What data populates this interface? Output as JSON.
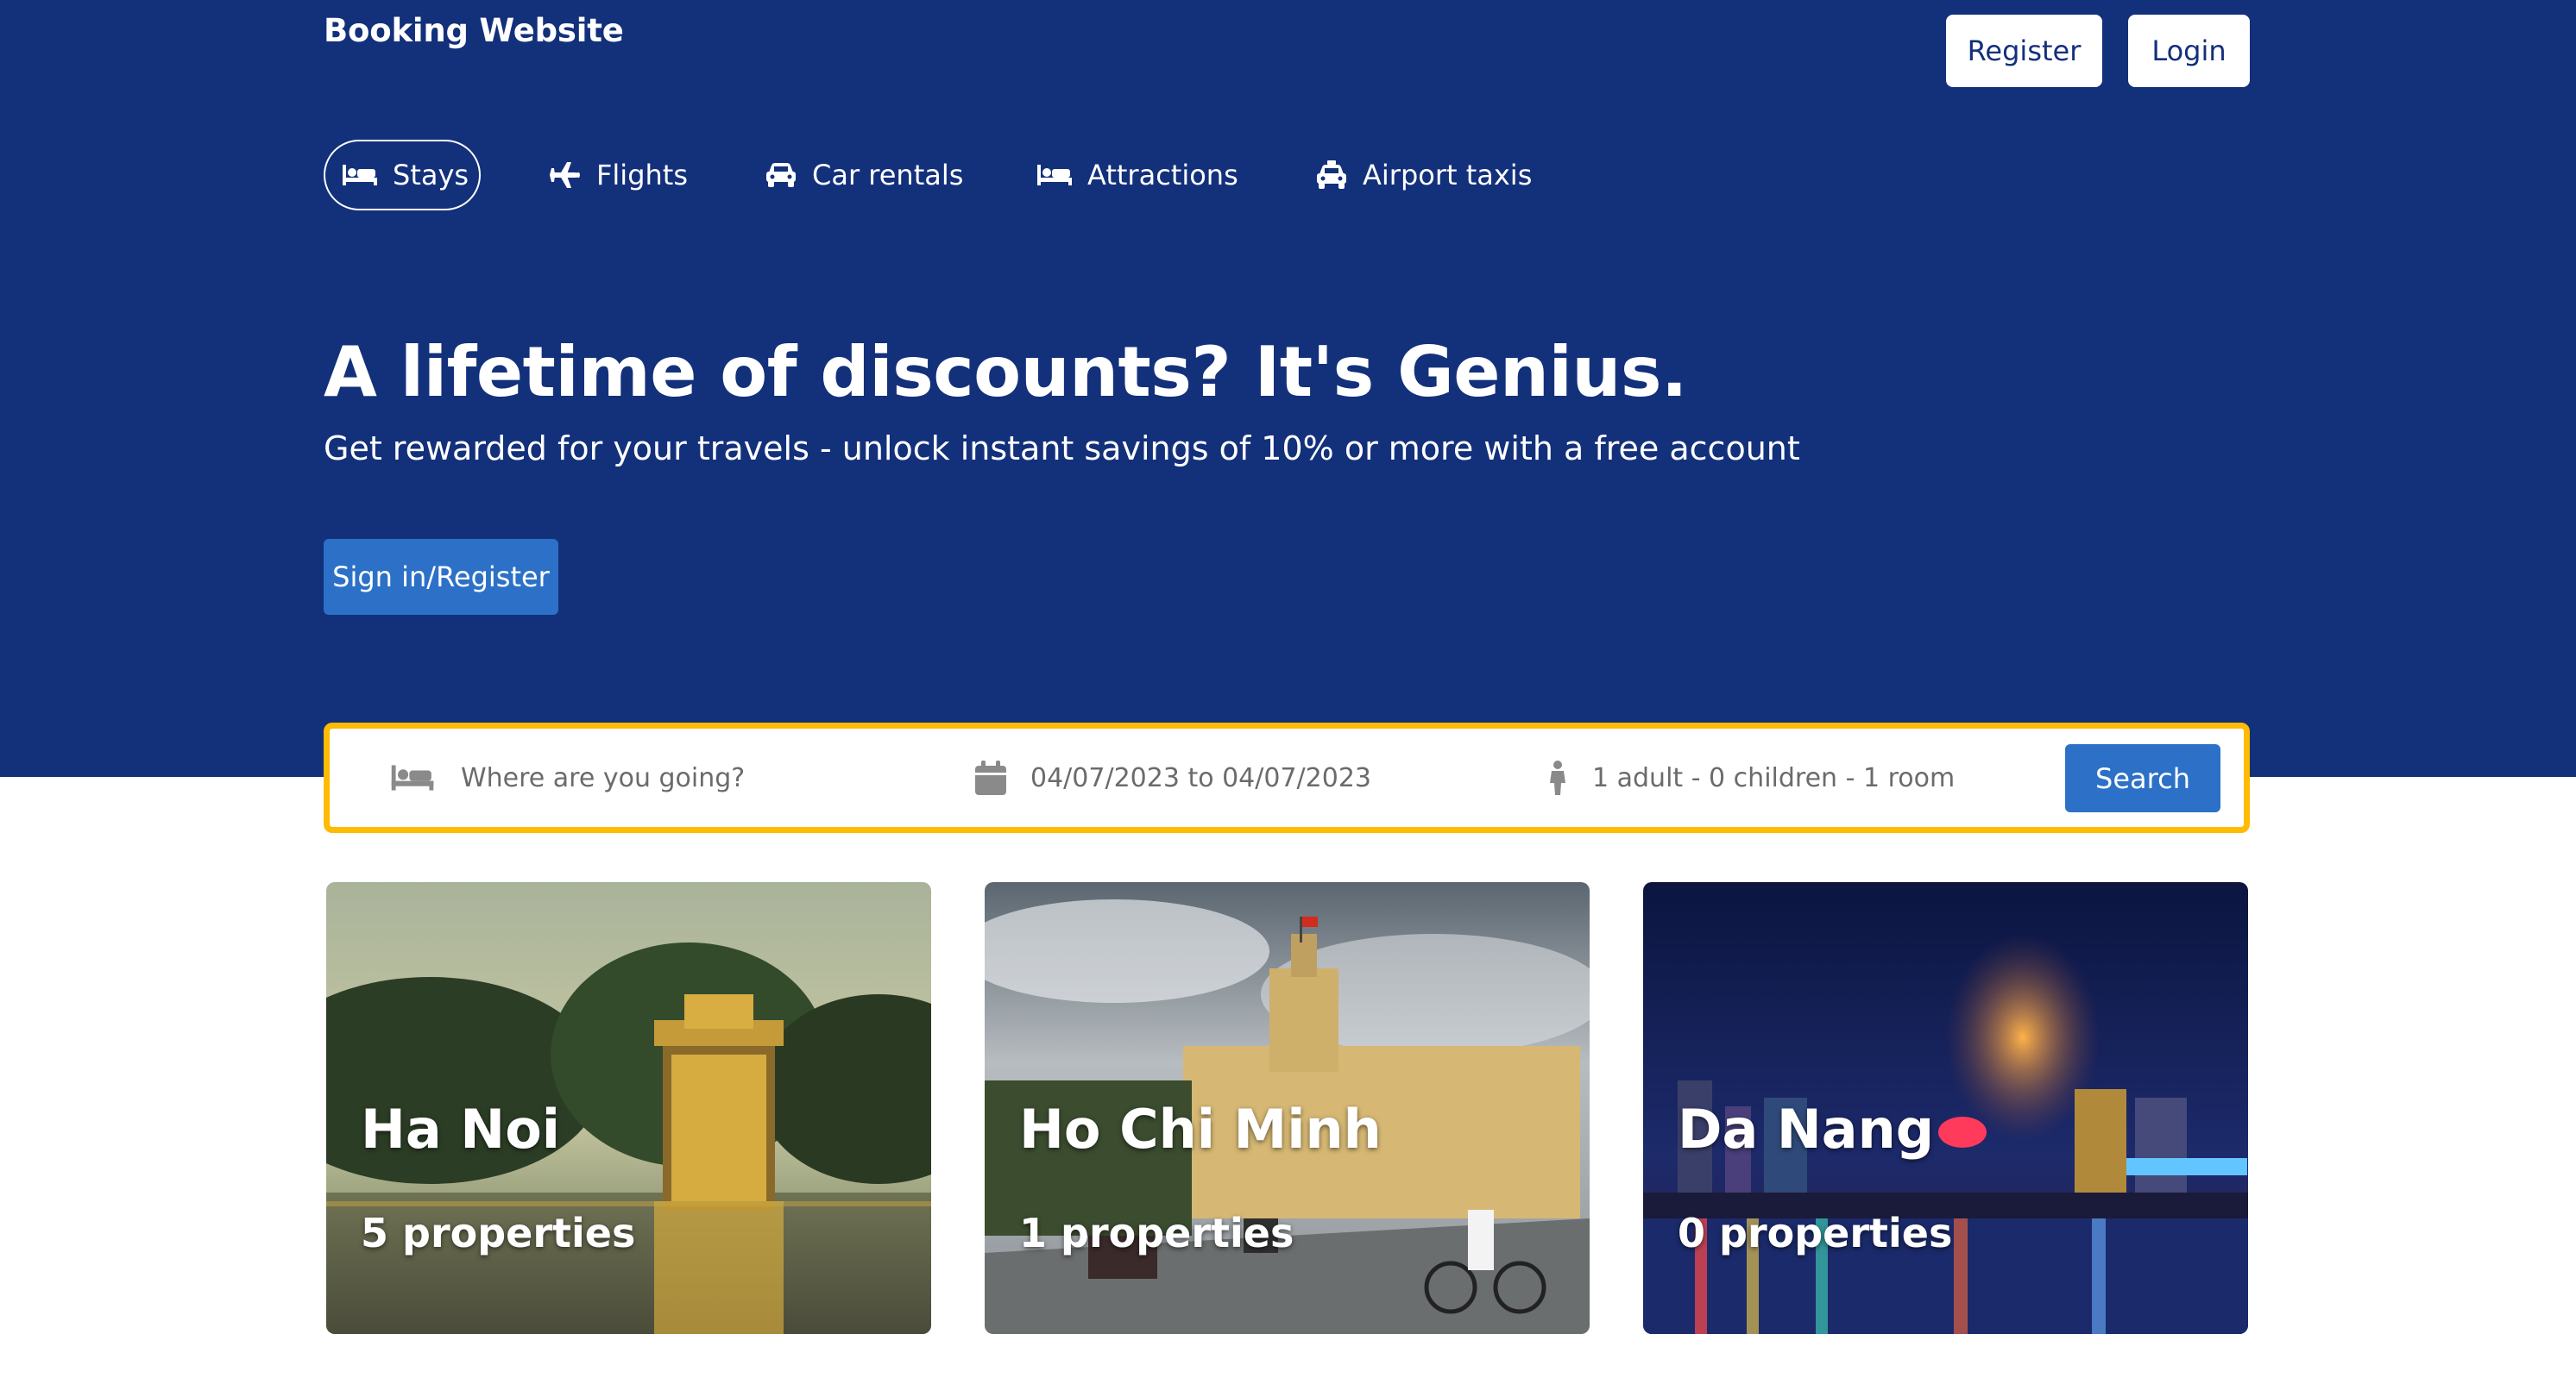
{
  "header": {
    "brand": "Booking Website",
    "register_label": "Register",
    "login_label": "Login"
  },
  "nav": {
    "items": [
      {
        "label": "Stays",
        "icon": "bed-icon",
        "active": true
      },
      {
        "label": "Flights",
        "icon": "plane-icon",
        "active": false
      },
      {
        "label": "Car rentals",
        "icon": "car-icon",
        "active": false
      },
      {
        "label": "Attractions",
        "icon": "bed-icon",
        "active": false
      },
      {
        "label": "Airport taxis",
        "icon": "taxi-icon",
        "active": false
      }
    ]
  },
  "hero": {
    "headline": "A lifetime of discounts? It's Genius.",
    "subline": "Get rewarded for your travels - unlock instant savings of 10% or more with a free account",
    "cta_label": "Sign in/Register"
  },
  "search": {
    "destination_placeholder": "Where are you going?",
    "dates": "04/07/2023 to 04/07/2023",
    "occupancy": "1 adult - 0 children - 1 room",
    "button_label": "Search"
  },
  "cities": [
    {
      "name": "Ha Noi",
      "properties": "5 properties"
    },
    {
      "name": "Ho Chi Minh",
      "properties": "1 properties"
    },
    {
      "name": "Da Nang",
      "properties": "0 properties"
    }
  ],
  "colors": {
    "hero_bg": "#13307b",
    "accent_button": "#2c71c7",
    "search_border": "#febb02",
    "icon_gray": "#8a8a8a"
  }
}
